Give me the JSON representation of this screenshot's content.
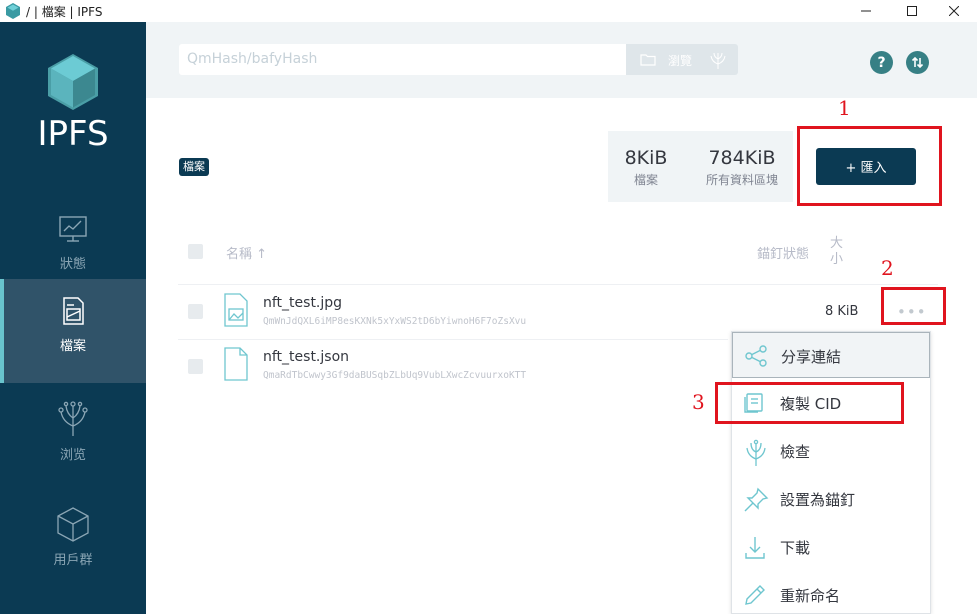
{
  "window": {
    "title": "/ | 檔案 | IPFS",
    "icon": "ipfs-cube-icon"
  },
  "sidebar": {
    "logo_text": "IPFS",
    "items": [
      {
        "label": "狀態",
        "icon": "status-chart-icon",
        "active": false
      },
      {
        "label": "檔案",
        "icon": "files-icon",
        "active": true
      },
      {
        "label": "浏览",
        "icon": "explore-tree-icon",
        "active": false
      },
      {
        "label": "用戶群",
        "icon": "peers-cube-icon",
        "active": false
      }
    ]
  },
  "header": {
    "search_placeholder": "QmHash/bafyHash",
    "browse_label": "瀏覽",
    "help_icon": "help-icon",
    "sync_icon": "sync-arrows-icon"
  },
  "breadcrumb": {
    "label": "檔案"
  },
  "stats": {
    "files_value": "8KiB",
    "files_label": "檔案",
    "blocks_value": "784KiB",
    "blocks_label": "所有資料區塊"
  },
  "import_button": {
    "label": "+ 匯入"
  },
  "table": {
    "header_name": "名稱 ↑",
    "header_pin": "錨釘狀態",
    "header_size": "大\n小",
    "rows": [
      {
        "name": "nft_test.jpg",
        "cid": "QmWnJdQXL6iMP8esKXNk5xYxWS2tD6bYiwnoH6F7oZsXvu",
        "size": "8 KiB",
        "icon": "image-file-icon"
      },
      {
        "name": "nft_test.json",
        "cid": "QmaRdTbCwwy3Gf9daBUSqbZLbUq9VubLXwcZcvuurxoKTT",
        "size": "",
        "icon": "file-icon"
      }
    ],
    "more_label": "•••"
  },
  "context_menu": {
    "items": [
      {
        "label": "分享連結",
        "icon": "share-icon",
        "highlighted": true
      },
      {
        "label": "複製 CID",
        "icon": "copy-icon",
        "highlighted": false
      },
      {
        "label": "檢查",
        "icon": "inspect-icon",
        "highlighted": false
      },
      {
        "label": "設置為錨釘",
        "icon": "pin-icon",
        "highlighted": false
      },
      {
        "label": "下載",
        "icon": "download-icon",
        "highlighted": false
      },
      {
        "label": "重新命名",
        "icon": "pencil-icon",
        "highlighted": false
      }
    ]
  },
  "annotations": {
    "step1": "1",
    "step2": "2",
    "step3": "3",
    "color": "#e0141e"
  },
  "colors": {
    "sidebar": "#0b3a53",
    "sidebar_active": "#305369",
    "accent_teal": "#69c4cd",
    "header_bg": "#f0f4f6"
  }
}
